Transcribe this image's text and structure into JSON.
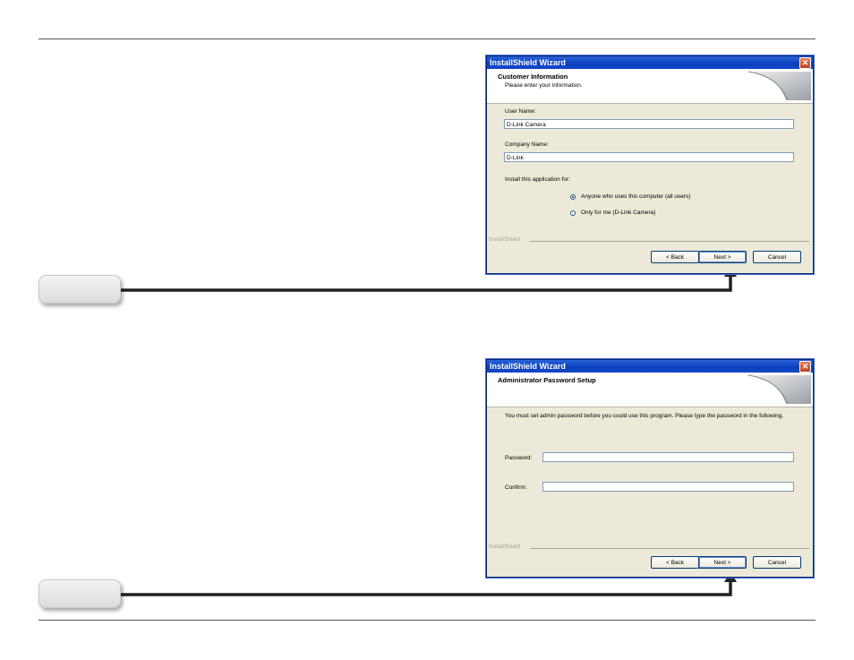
{
  "dialog1": {
    "window_title": "InstallShield Wizard",
    "header_title": "Customer Information",
    "header_subtitle": "Please enter your information.",
    "user_name_label": "User Name:",
    "user_name_value": "D-Link Camera",
    "company_name_label": "Company Name:",
    "company_name_value": "D-Link",
    "install_for_label": "Install this application for:",
    "radio_all_users": "Anyone who uses this computer (all users)",
    "radio_only_me": "Only for me (D-Link Camera)",
    "selected_option": "all_users",
    "branding": "InstallShield",
    "back_label": "< Back",
    "next_label": "Next >",
    "cancel_label": "Cancel"
  },
  "dialog2": {
    "window_title": "InstallShield Wizard",
    "header_title": "Administrator Password Setup",
    "instructions": "You must set admin password before you could use this program. Please type the password in the following.",
    "password_label": "Password:",
    "password_value": "",
    "confirm_label": "Confirm:",
    "confirm_value": "",
    "branding": "InstallShield",
    "back_label": "< Back",
    "next_label": "Next >",
    "cancel_label": "Cancel"
  },
  "colors": {
    "title_bar": "#0a3fbd",
    "dialog_bg": "#ece9d8",
    "connector": "#222222"
  }
}
